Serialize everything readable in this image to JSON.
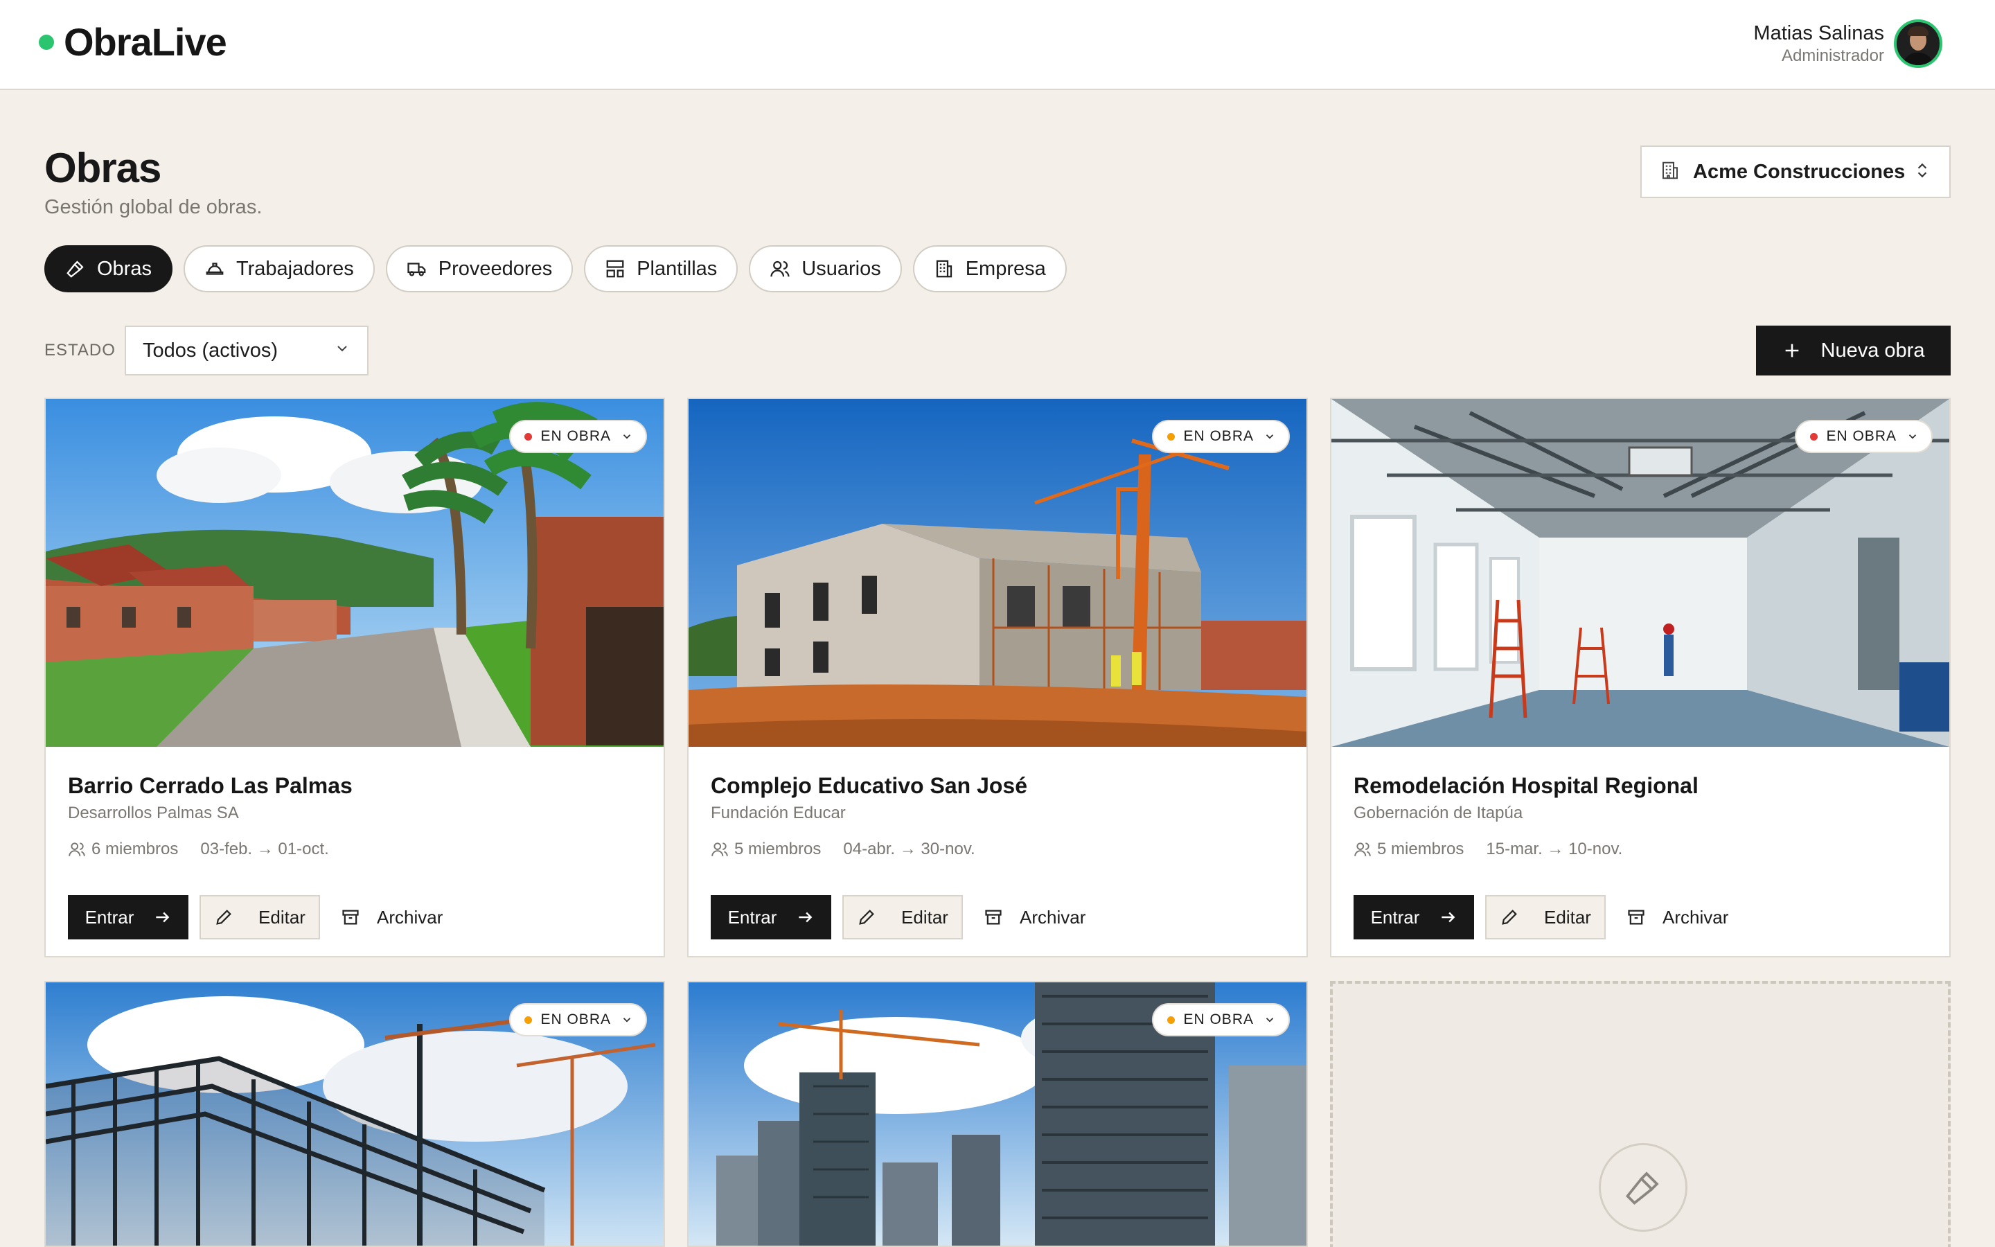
{
  "app": {
    "name": "ObraLive"
  },
  "user": {
    "name": "Matias Salinas",
    "role": "Administrador"
  },
  "page": {
    "title": "Obras",
    "subtitle": "Gestión global de obras."
  },
  "company": {
    "selected": "Acme Construcciones"
  },
  "tabs": [
    {
      "label": "Obras",
      "icon": "hammer-icon",
      "active": true
    },
    {
      "label": "Trabajadores",
      "icon": "hard-hat-icon"
    },
    {
      "label": "Proveedores",
      "icon": "truck-icon"
    },
    {
      "label": "Plantillas",
      "icon": "layout-template-icon"
    },
    {
      "label": "Usuarios",
      "icon": "users-icon"
    },
    {
      "label": "Empresa",
      "icon": "building-icon"
    }
  ],
  "filter": {
    "label": "ESTADO",
    "value": "Todos (activos)"
  },
  "actions": {
    "new_label": "Nueva obra"
  },
  "card_buttons": {
    "enter": "Entrar",
    "edit": "Editar",
    "archive": "Archivar"
  },
  "colors": {
    "accent": "#2bc56f",
    "status_red": "#e53935",
    "status_orange": "#f5a000",
    "dark": "#181818",
    "background": "#f4f0e9"
  },
  "projects": [
    {
      "title": "Barrio Cerrado Las Palmas",
      "client": "Desarrollos Palmas SA",
      "members": "6 miembros",
      "dates": "03-feb. → 01-oct.",
      "status": "EN OBRA",
      "status_color": "#e53935"
    },
    {
      "title": "Complejo Educativo San José",
      "client": "Fundación Educar",
      "members": "5 miembros",
      "dates": "04-abr. → 30-nov.",
      "status": "EN OBRA",
      "status_color": "#f5a000"
    },
    {
      "title": "Remodelación Hospital Regional",
      "client": "Gobernación de Itapúa",
      "members": "5 miembros",
      "dates": "15-mar. → 10-nov.",
      "status": "EN OBRA",
      "status_color": "#e53935"
    },
    {
      "status": "EN OBRA",
      "status_color": "#f5a000"
    },
    {
      "status": "EN OBRA",
      "status_color": "#f5a000"
    }
  ]
}
